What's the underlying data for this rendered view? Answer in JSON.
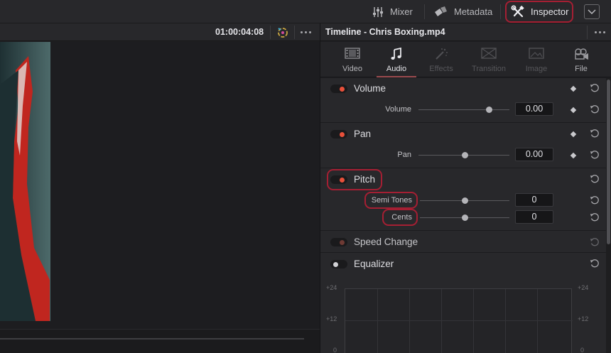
{
  "toolbar": {
    "mixer_label": "Mixer",
    "metadata_label": "Metadata",
    "inspector_label": "Inspector"
  },
  "viewer": {
    "timecode": "01:00:04:08"
  },
  "inspector": {
    "title": "Timeline - Chris Boxing.mp4",
    "tabs": [
      {
        "label": "Video",
        "icon": "film-icon",
        "state": "normal"
      },
      {
        "label": "Audio",
        "icon": "music-note-icon",
        "state": "active"
      },
      {
        "label": "Effects",
        "icon": "magic-wand-icon",
        "state": "disabled"
      },
      {
        "label": "Transition",
        "icon": "transition-icon",
        "state": "disabled"
      },
      {
        "label": "Image",
        "icon": "image-icon",
        "state": "disabled"
      },
      {
        "label": "File",
        "icon": "file-reel-icon",
        "state": "normal"
      }
    ],
    "sections": {
      "volume": {
        "title": "Volume",
        "enabled": true,
        "param_label": "Volume",
        "value": "0.00"
      },
      "pan": {
        "title": "Pan",
        "enabled": true,
        "param_label": "Pan",
        "value": "0.00"
      },
      "pitch": {
        "title": "Pitch",
        "enabled": true,
        "semitones_label": "Semi Tones",
        "semitones_value": "0",
        "cents_label": "Cents",
        "cents_value": "0"
      },
      "speed_change": {
        "title": "Speed Change",
        "enabled": false
      },
      "equalizer": {
        "title": "Equalizer",
        "enabled": false,
        "scale_labels": [
          "+24",
          "+12",
          "0"
        ]
      }
    }
  },
  "colors": {
    "accent_red": "#e8503a",
    "highlight": "#a51f33",
    "panel_bg": "#28282b"
  }
}
